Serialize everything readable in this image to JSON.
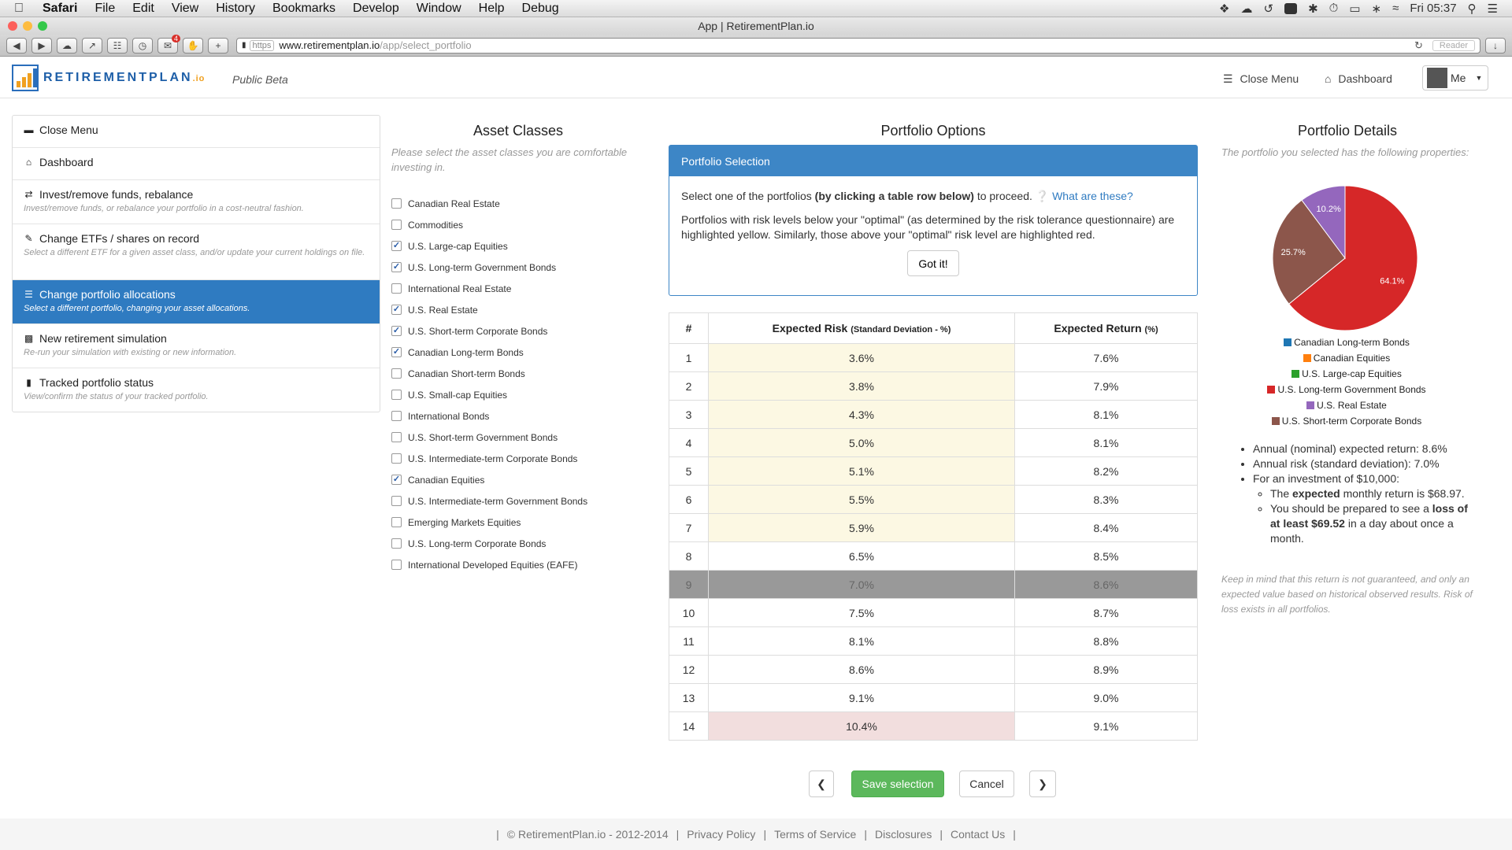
{
  "menubar": {
    "app": "Safari",
    "items": [
      "File",
      "Edit",
      "View",
      "History",
      "Bookmarks",
      "Develop",
      "Window",
      "Help",
      "Debug"
    ],
    "clock": "Fri 05:37"
  },
  "browser": {
    "window_title": "App | RetirementPlan.io",
    "scheme": "https",
    "host": "www.retirementplan.io",
    "path": "/app/select_portfolio",
    "reader": "Reader",
    "badge_count": "4"
  },
  "header": {
    "logo_main": "RetirementPlan",
    "logo_suffix": ".io",
    "beta": "Public Beta",
    "close_menu": "Close Menu",
    "dashboard": "Dashboard",
    "user": "Me"
  },
  "sidebar": {
    "items": [
      {
        "title": "Close Menu",
        "desc": ""
      },
      {
        "title": "Dashboard",
        "desc": ""
      },
      {
        "title": "Invest/remove funds, rebalance",
        "desc": "Invest/remove funds, or rebalance your portfolio in a cost-neutral fashion."
      },
      {
        "title": "Change ETFs / shares on record",
        "desc": "Select a different ETF for a given asset class, and/or update your current holdings on file."
      },
      {
        "title": "Change portfolio allocations",
        "desc": "Select a different portfolio, changing your asset allocations."
      },
      {
        "title": "New retirement simulation",
        "desc": "Re-run your simulation with existing or new information."
      },
      {
        "title": "Tracked portfolio status",
        "desc": "View/confirm the status of your tracked portfolio."
      }
    ]
  },
  "assets": {
    "title": "Asset Classes",
    "help": "Please select the asset classes you are comfortable investing in.",
    "items": [
      {
        "label": "Canadian Real Estate",
        "checked": false
      },
      {
        "label": "Commodities",
        "checked": false
      },
      {
        "label": "U.S. Large-cap Equities",
        "checked": true
      },
      {
        "label": "U.S. Long-term Government Bonds",
        "checked": true
      },
      {
        "label": "International Real Estate",
        "checked": false
      },
      {
        "label": "U.S. Real Estate",
        "checked": true
      },
      {
        "label": "U.S. Short-term Corporate Bonds",
        "checked": true
      },
      {
        "label": "Canadian Long-term Bonds",
        "checked": true
      },
      {
        "label": "Canadian Short-term Bonds",
        "checked": false
      },
      {
        "label": "U.S. Small-cap Equities",
        "checked": false
      },
      {
        "label": "International Bonds",
        "checked": false
      },
      {
        "label": "U.S. Short-term Government Bonds",
        "checked": false
      },
      {
        "label": "U.S. Intermediate-term Corporate Bonds",
        "checked": false
      },
      {
        "label": "Canadian Equities",
        "checked": true
      },
      {
        "label": "U.S. Intermediate-term Government Bonds",
        "checked": false
      },
      {
        "label": "Emerging Markets Equities",
        "checked": false
      },
      {
        "label": "U.S. Long-term Corporate Bonds",
        "checked": false
      },
      {
        "label": "International Developed Equities (EAFE)",
        "checked": false
      }
    ]
  },
  "options": {
    "title": "Portfolio Options",
    "panel_title": "Portfolio Selection",
    "line1_pre": "Select one of the portfolios ",
    "line1_bold": "(by clicking a table row below)",
    "line1_post": " to proceed.",
    "what": "What are these?",
    "line2": "Portfolios with risk levels below your \"optimal\" (as determined by the risk tolerance questionnaire) are highlighted yellow. Similarly, those above your \"optimal\" risk level are highlighted red.",
    "got_it": "Got it!",
    "col_num": "#",
    "col_risk": "Expected Risk",
    "col_risk_small": "(Standard Deviation - %)",
    "col_return": "Expected Return",
    "col_return_small": "(%)",
    "selected_row": 9,
    "rows": [
      {
        "n": "1",
        "risk": "3.6%",
        "ret": "7.6%",
        "hl": "yellow"
      },
      {
        "n": "2",
        "risk": "3.8%",
        "ret": "7.9%",
        "hl": "yellow"
      },
      {
        "n": "3",
        "risk": "4.3%",
        "ret": "8.1%",
        "hl": "yellow"
      },
      {
        "n": "4",
        "risk": "5.0%",
        "ret": "8.1%",
        "hl": "yellow"
      },
      {
        "n": "5",
        "risk": "5.1%",
        "ret": "8.2%",
        "hl": "yellow"
      },
      {
        "n": "6",
        "risk": "5.5%",
        "ret": "8.3%",
        "hl": "yellow"
      },
      {
        "n": "7",
        "risk": "5.9%",
        "ret": "8.4%",
        "hl": "yellow"
      },
      {
        "n": "8",
        "risk": "6.5%",
        "ret": "8.5%",
        "hl": ""
      },
      {
        "n": "9",
        "risk": "7.0%",
        "ret": "8.6%",
        "hl": ""
      },
      {
        "n": "10",
        "risk": "7.5%",
        "ret": "8.7%",
        "hl": ""
      },
      {
        "n": "11",
        "risk": "8.1%",
        "ret": "8.8%",
        "hl": ""
      },
      {
        "n": "12",
        "risk": "8.6%",
        "ret": "8.9%",
        "hl": ""
      },
      {
        "n": "13",
        "risk": "9.1%",
        "ret": "9.0%",
        "hl": ""
      },
      {
        "n": "14",
        "risk": "10.4%",
        "ret": "9.1%",
        "hl": "red"
      }
    ]
  },
  "details": {
    "title": "Portfolio Details",
    "help": "The portfolio you selected has the following properties:",
    "slices": [
      {
        "label": "64.1%",
        "value": 64.1,
        "color": "#d62728"
      },
      {
        "label": "25.7%",
        "value": 25.7,
        "color": "#8c564b"
      },
      {
        "label": "10.2%",
        "value": 10.2,
        "color": "#9467bd"
      }
    ],
    "legend": [
      {
        "name": "Canadian Long-term Bonds",
        "color": "#1f77b4"
      },
      {
        "name": "Canadian Equities",
        "color": "#ff7f0e"
      },
      {
        "name": "U.S. Large-cap Equities",
        "color": "#2ca02c"
      },
      {
        "name": "U.S. Long-term Government Bonds",
        "color": "#d62728"
      },
      {
        "name": "U.S. Real Estate",
        "color": "#9467bd"
      },
      {
        "name": "U.S. Short-term Corporate Bonds",
        "color": "#8c564b"
      }
    ],
    "b1": "Annual (nominal) expected return: 8.6%",
    "b2": "Annual risk (standard deviation): 7.0%",
    "b3": "For an investment of $10,000:",
    "s1_pre": "The ",
    "s1_bold": "expected",
    "s1_post": " monthly return is $68.97.",
    "s2_pre": "You should be prepared to see a ",
    "s2_bold": "loss of at least $69.52",
    "s2_post": " in a day about once a month.",
    "note": "Keep in mind that this return is not guaranteed, and only an expected value based on historical observed results. Risk of loss exists in all portfolios."
  },
  "actions": {
    "save": "Save selection",
    "cancel": "Cancel"
  },
  "footer": {
    "copyright": "© RetirementPlan.io - 2012-2014",
    "privacy": "Privacy Policy",
    "terms": "Terms of Service",
    "disclosures": "Disclosures",
    "contact": "Contact Us"
  }
}
